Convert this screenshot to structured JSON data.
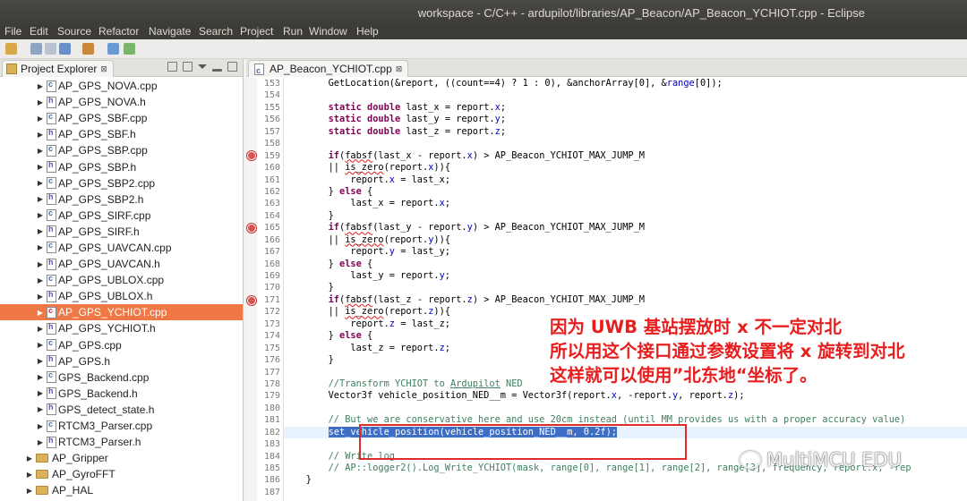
{
  "window": {
    "title": "workspace - C/C++ - ardupilot/libraries/AP_Beacon/AP_Beacon_YCHIOT.cpp - Eclipse"
  },
  "menu": [
    "File",
    "Edit",
    "Source",
    "Refactor",
    "Navigate",
    "Search",
    "Project",
    "Run",
    "Window",
    "Help"
  ],
  "explorer": {
    "tab_label": "Project Explorer",
    "tab_close": "⊠",
    "items": [
      {
        "label": "AP_GPS_NOVA.cpp",
        "type": "cpp"
      },
      {
        "label": "AP_GPS_NOVA.h",
        "type": "h"
      },
      {
        "label": "AP_GPS_SBF.cpp",
        "type": "cpp"
      },
      {
        "label": "AP_GPS_SBF.h",
        "type": "h"
      },
      {
        "label": "AP_GPS_SBP.cpp",
        "type": "cpp"
      },
      {
        "label": "AP_GPS_SBP.h",
        "type": "h"
      },
      {
        "label": "AP_GPS_SBP2.cpp",
        "type": "cpp"
      },
      {
        "label": "AP_GPS_SBP2.h",
        "type": "h"
      },
      {
        "label": "AP_GPS_SIRF.cpp",
        "type": "cpp"
      },
      {
        "label": "AP_GPS_SIRF.h",
        "type": "h"
      },
      {
        "label": "AP_GPS_UAVCAN.cpp",
        "type": "cpp"
      },
      {
        "label": "AP_GPS_UAVCAN.h",
        "type": "h"
      },
      {
        "label": "AP_GPS_UBLOX.cpp",
        "type": "cpp"
      },
      {
        "label": "AP_GPS_UBLOX.h",
        "type": "h"
      },
      {
        "label": "AP_GPS_YCHIOT.cpp",
        "type": "cpp",
        "selected": true
      },
      {
        "label": "AP_GPS_YCHIOT.h",
        "type": "h"
      },
      {
        "label": "AP_GPS.cpp",
        "type": "cpp"
      },
      {
        "label": "AP_GPS.h",
        "type": "h"
      },
      {
        "label": "GPS_Backend.cpp",
        "type": "cpp"
      },
      {
        "label": "GPS_Backend.h",
        "type": "h"
      },
      {
        "label": "GPS_detect_state.h",
        "type": "h"
      },
      {
        "label": "RTCM3_Parser.cpp",
        "type": "cpp"
      },
      {
        "label": "RTCM3_Parser.h",
        "type": "h"
      }
    ],
    "folders": [
      "AP_Gripper",
      "AP_GyroFFT",
      "AP_HAL"
    ]
  },
  "editor": {
    "tab_label": "AP_Beacon_YCHIOT.cpp",
    "tab_close": "⊠",
    "line_numbers": [
      "153",
      "154",
      "155",
      "156",
      "157",
      "158",
      "159",
      "160",
      "161",
      "162",
      "163",
      "164",
      "165",
      "166",
      "167",
      "168",
      "169",
      "170",
      "171",
      "172",
      "173",
      "174",
      "175",
      "176",
      "177",
      "178",
      "179",
      "180",
      "181",
      "182",
      "183",
      "184",
      "185",
      "186",
      "187"
    ],
    "breakpoint_lines": [
      "159",
      "165",
      "171"
    ]
  },
  "annotation": {
    "line1": "因为 UWB 基站摆放时 x 不一定对北",
    "line2": "所以用这个接口通过参数设置将 x 旋转到对北",
    "line3": "这样就可以使用”北东地“坐标了。"
  },
  "watermark": {
    "text": "MultiMCU EDU"
  }
}
